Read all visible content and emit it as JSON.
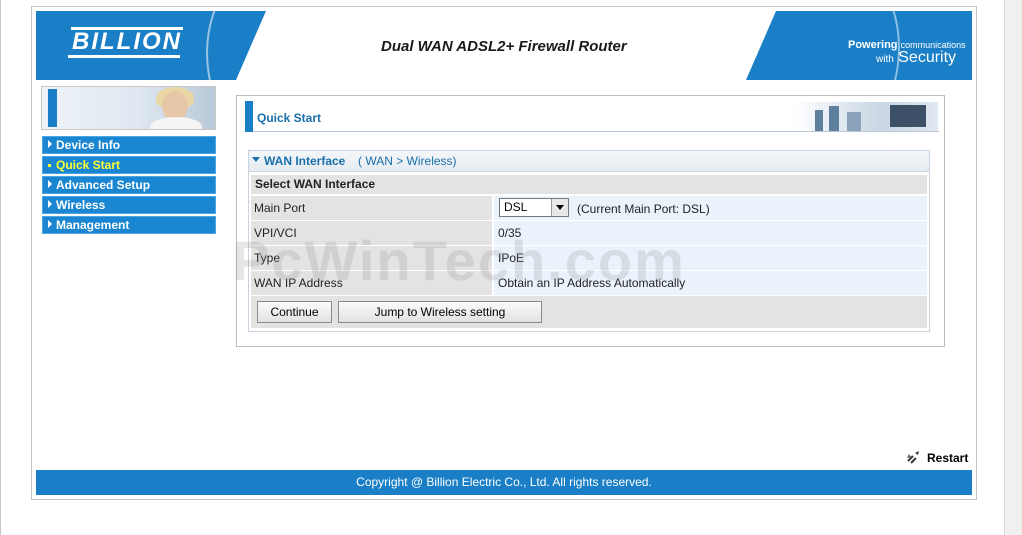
{
  "header": {
    "logo": "BILLION",
    "product_title": "Dual WAN ADSL2+ Firewall Router",
    "tagline_powering": "Powering",
    "tagline_communications": "communications",
    "tagline_with": "with",
    "tagline_security": "Security"
  },
  "menu": {
    "items": [
      {
        "label": "Device Info"
      },
      {
        "label": "Quick Start"
      },
      {
        "label": "Advanced Setup"
      },
      {
        "label": "Wireless"
      },
      {
        "label": "Management"
      }
    ],
    "active": "Quick Start"
  },
  "page": {
    "title": "Quick Start"
  },
  "section": {
    "title": "WAN Interface",
    "breadcrumb": "( WAN > Wireless)",
    "subheader": "Select WAN Interface",
    "rows": [
      {
        "label": "Main Port",
        "value": "(Current Main Port: DSL)"
      },
      {
        "label": "VPI/VCI",
        "value": "0/35"
      },
      {
        "label": "Type",
        "value": "IPoE"
      },
      {
        "label": "WAN IP Address",
        "value": "Obtain an IP Address Automatically"
      }
    ],
    "main_port_select": "DSL",
    "buttons": {
      "continue": "Continue",
      "jump": "Jump to Wireless setting"
    }
  },
  "watermark": "PcWinTech.com",
  "restart_label": "Restart",
  "footer": "Copyright @ Billion Electric Co., Ltd. All rights reserved.",
  "colors": {
    "brand_blue": "#1a7fc6",
    "menu_blue": "#1a86d1",
    "active_menu_text": "#ffff33",
    "heading_blue": "#1a6faa"
  }
}
